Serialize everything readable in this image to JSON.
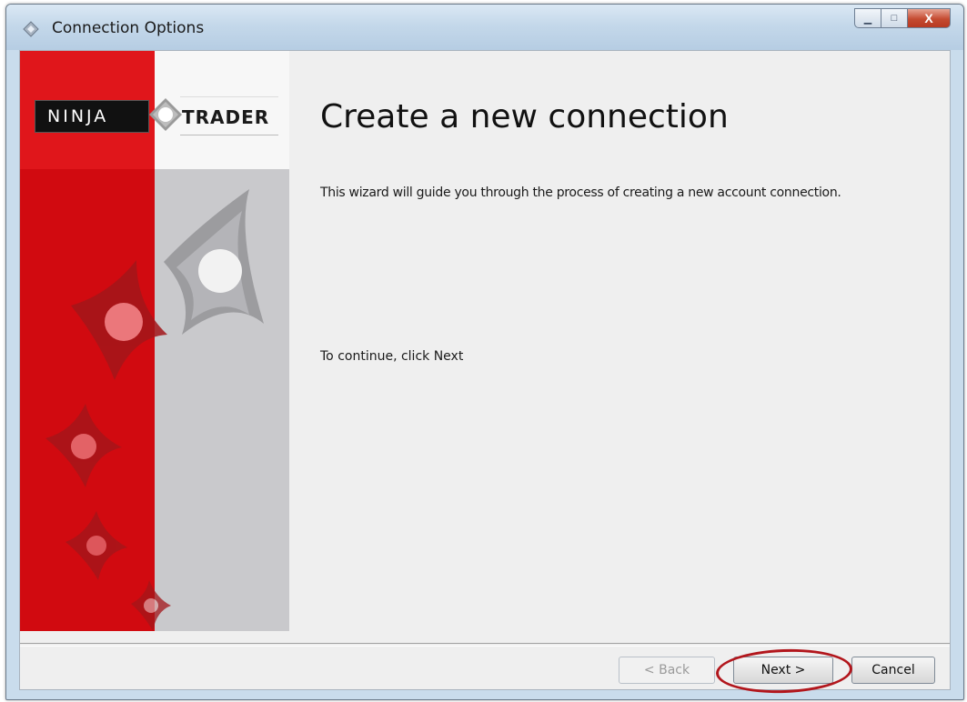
{
  "window": {
    "title": "Connection Options",
    "caption_buttons": {
      "minimize": "▁",
      "maximize": "□",
      "close": "X"
    }
  },
  "brand": {
    "left_word": "NINJA",
    "right_word": "TRADER"
  },
  "main": {
    "heading": "Create a new connection",
    "description": "This wizard will guide you through the process of creating a new account connection.",
    "continue_text": "To continue, click Next"
  },
  "buttons": {
    "back": "< Back",
    "next": "Next >",
    "cancel": "Cancel"
  },
  "colors": {
    "brand_red": "#d10a10",
    "panel_gray": "#c9c9cc",
    "highlight": "#b2161c"
  }
}
